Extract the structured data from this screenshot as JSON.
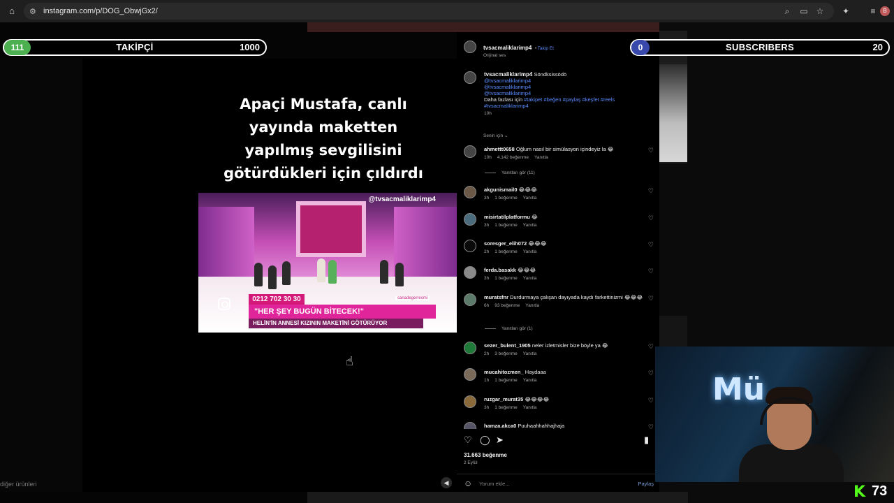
{
  "browser": {
    "url": "instagram.com/p/DOG_ObwjGx2/",
    "home_icon": "home-icon",
    "icons": [
      "zoom-icon",
      "cast-icon",
      "star-icon",
      "extensions-icon",
      "media-icon"
    ],
    "profile_initial": "B"
  },
  "overlay": {
    "left_goal": {
      "current": "111",
      "title": "TAKİPÇİ",
      "target": "1000",
      "color": "#4caf50"
    },
    "right_goal": {
      "current": "0",
      "title": "SUBSCRIBERS",
      "target": "20",
      "color": "#3949ab"
    },
    "kick_logo": "K",
    "viewer_count": "73"
  },
  "post": {
    "caption_lines": [
      "Apaçi Mustafa, canlı",
      "yayında maketten",
      "yapılmış sevgilisini",
      "götürdükleri için çıldırdı"
    ],
    "video": {
      "handle": "@tvsacmaliklarimp4",
      "phone": "0212 702 30 30",
      "headline": "\"HER ŞEY BUGÜN BİTECEK!\"",
      "subline": "HELİN'İN ANNESİ KIZININ MAKETİNİ GÖTÜRÜYOR",
      "channel": "sanadegerresmi",
      "show_logo": "SANA DEĞER"
    },
    "left_footer": "diğer ürünleri"
  },
  "comments_panel": {
    "author": "tvsacmaliklarimp4",
    "follow": "Takip Et",
    "audio": "Orijinal ses",
    "caption_user": "tvsacmaliklarimp4",
    "caption_text": "Söndksissödö",
    "mentions": [
      "@tvsacmaliklarimp4",
      "@tvsacmaliklarimp4",
      "@tvsacmaliklarimp4"
    ],
    "more_prefix": "Daha fazlası için",
    "tags1": "#takipet #beğen #paylaş #keşfet #reels",
    "tags2": "#tvsacmaliklarimp4",
    "caption_time": "10h",
    "for_you": "Senin için ⌄",
    "comments": [
      {
        "user": "ahmettt0658",
        "text": "Oğlum nasıl bir simülasyon içindeyiz la 😂",
        "time": "10h",
        "likes": "4.142 beğenme",
        "reply": "Yanıtla",
        "replies": "Yanıtları gör (11)"
      },
      {
        "user": "akgunismail0",
        "text": "😂😂😂",
        "time": "3h",
        "likes": "1 beğenme",
        "reply": "Yanıtla"
      },
      {
        "user": "misirtatilplatformu",
        "text": "😂",
        "time": "3h",
        "likes": "1 beğenme",
        "reply": "Yanıtla"
      },
      {
        "user": "soresger_elih072",
        "text": "😂😂😂",
        "time": "2h",
        "likes": "1 beğenme",
        "reply": "Yanıtla"
      },
      {
        "user": "ferda.basakk",
        "text": "😂😂😂",
        "time": "3h",
        "likes": "1 beğenme",
        "reply": "Yanıtla"
      },
      {
        "user": "muratsfnr",
        "text": "Durdurmaya çalışan dayıyada kaydı farkettinizmi 😂😂😂",
        "time": "6h",
        "likes": "93 beğenme",
        "reply": "Yanıtla",
        "replies": "Yanıtları gör (1)"
      },
      {
        "user": "sezer_bulent_1905",
        "text": "neler izletmisler bize böyle ya 😂",
        "time": "2h",
        "likes": "3 beğenme",
        "reply": "Yanıtla"
      },
      {
        "user": "mucahitozmen_",
        "text": "Haydaaa",
        "time": "1h",
        "likes": "1 beğenme",
        "reply": "Yanıtla"
      },
      {
        "user": "ruzgar_murat35",
        "text": "😂😂😂😂",
        "time": "3h",
        "likes": "1 beğenme",
        "reply": "Yanıtla"
      },
      {
        "user": "hamza.akca0",
        "text": "Puuhaahhahhajhaja",
        "time": "",
        "likes": "",
        "reply": ""
      }
    ],
    "like_total": "31.663 beğenme",
    "date": "2 Eylül",
    "comment_placeholder": "Yorum ekle...",
    "share": "Paylaş"
  }
}
